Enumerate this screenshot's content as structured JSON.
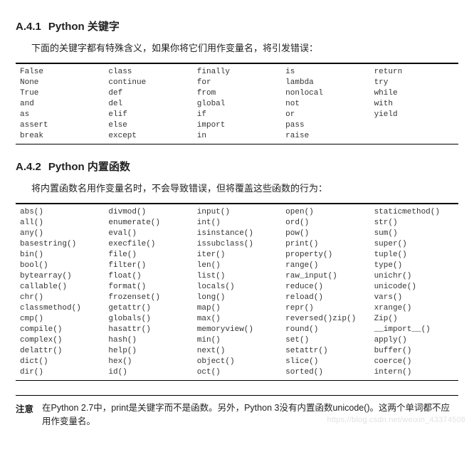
{
  "section1": {
    "number": "A.4.1",
    "title": "Python 关键字",
    "intro": "下面的关键字都有特殊含义，如果你将它们用作变量名，将引发错误：",
    "rows": [
      [
        "False",
        "class",
        "finally",
        "is",
        "return"
      ],
      [
        "None",
        "continue",
        "for",
        "lambda",
        "try"
      ],
      [
        "True",
        "def",
        "from",
        "nonlocal",
        "while"
      ],
      [
        "and",
        "del",
        "global",
        "not",
        "with"
      ],
      [
        "as",
        "elif",
        "if",
        "or",
        "yield"
      ],
      [
        "assert",
        "else",
        "import",
        "pass",
        ""
      ],
      [
        "break",
        "except",
        "in",
        "raise",
        ""
      ]
    ]
  },
  "section2": {
    "number": "A.4.2",
    "title": "Python 内置函数",
    "intro": "将内置函数名用作变量名时，不会导致错误，但将覆盖这些函数的行为：",
    "rows": [
      [
        "abs()",
        "divmod()",
        "input()",
        "open()",
        "staticmethod()"
      ],
      [
        "all()",
        "enumerate()",
        "int()",
        "ord()",
        "str()"
      ],
      [
        "any()",
        "eval()",
        "isinstance()",
        "pow()",
        "sum()"
      ],
      [
        "basestring()",
        "execfile()",
        "issubclass()",
        "print()",
        "super()"
      ],
      [
        "bin()",
        "file()",
        "iter()",
        "property()",
        "tuple()"
      ],
      [
        "bool()",
        "filter()",
        "len()",
        "range()",
        "type()"
      ],
      [
        "bytearray()",
        "float()",
        "list()",
        "raw_input()",
        "unichr()"
      ],
      [
        "callable()",
        "format()",
        "locals()",
        "reduce()",
        "unicode()"
      ],
      [
        "chr()",
        "frozenset()",
        "long()",
        "reload()",
        "vars()"
      ],
      [
        "classmethod()",
        "getattr()",
        "map()",
        "repr()",
        "xrange()"
      ],
      [
        "cmp()",
        "globals()",
        "max()",
        "reversed()zip()",
        "Zip()"
      ],
      [
        "compile()",
        "hasattr()",
        "memoryview()",
        "round()",
        "__import__()"
      ],
      [
        "complex()",
        "hash()",
        "min()",
        "set()",
        "apply()"
      ],
      [
        "delattr()",
        "help()",
        "next()",
        "setattr()",
        "buffer()"
      ],
      [
        "dict()",
        "hex()",
        "object()",
        "slice()",
        "coerce()"
      ],
      [
        "dir()",
        "id()",
        "oct()",
        "sorted()",
        "intern()"
      ]
    ]
  },
  "note": {
    "label": "注意",
    "text": "在Python 2.7中，print是关键字而不是函数。另外，Python 3没有内置函数unicode()。这两个单词都不应用作变量名。"
  },
  "watermark": "https://blog.csdn.net/weixin_43374508"
}
